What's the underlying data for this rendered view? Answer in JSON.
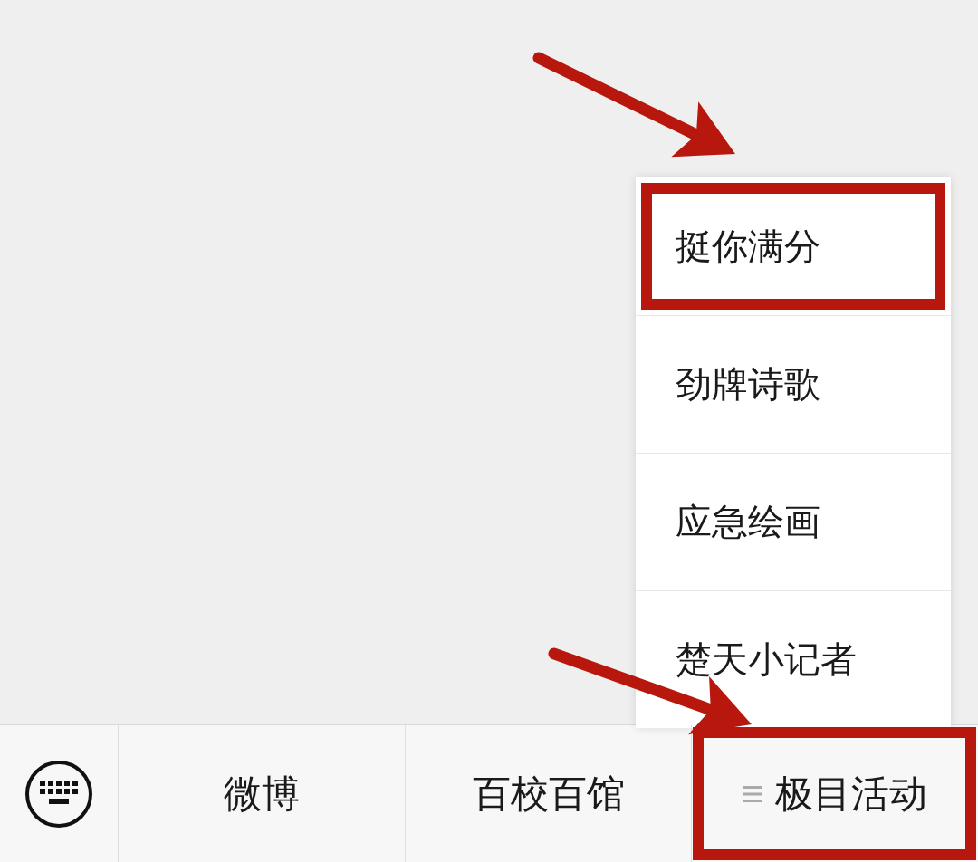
{
  "menu_popup": {
    "items": [
      {
        "label": "挺你满分",
        "highlighted": true
      },
      {
        "label": "劲牌诗歌",
        "highlighted": false
      },
      {
        "label": "应急绘画",
        "highlighted": false
      },
      {
        "label": "楚天小记者",
        "highlighted": false
      }
    ]
  },
  "bottom_bar": {
    "tabs": [
      {
        "label": "微博",
        "has_submenu": false,
        "highlighted": false
      },
      {
        "label": "百校百馆",
        "has_submenu": false,
        "highlighted": false
      },
      {
        "label": "极目活动",
        "has_submenu": true,
        "highlighted": true
      }
    ]
  }
}
